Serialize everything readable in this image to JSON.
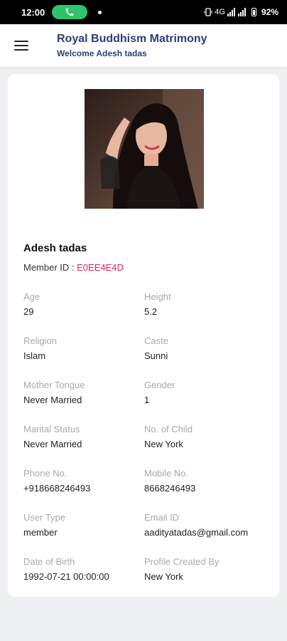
{
  "status_bar": {
    "time": "12:00",
    "network": "4G",
    "battery": "92%"
  },
  "app_bar": {
    "title": "Royal Buddhism Matrimony",
    "subtitle": "Welcome Adesh tadas"
  },
  "profile": {
    "name": "Adesh tadas",
    "member_id_label": "Member ID : ",
    "member_id": "E0EE4E4D",
    "fields": [
      {
        "label": "Age",
        "value": "29"
      },
      {
        "label": "Height",
        "value": "5.2"
      },
      {
        "label": "Religion",
        "value": "Islam"
      },
      {
        "label": "Caste",
        "value": "Sunni"
      },
      {
        "label": "Mother Tongue",
        "value": "Never Married"
      },
      {
        "label": "Gender",
        "value": "1"
      },
      {
        "label": "Marital Status",
        "value": "Never Married"
      },
      {
        "label": "No. of Child",
        "value": "New York"
      },
      {
        "label": "Phone No.",
        "value": "+918668246493"
      },
      {
        "label": "Mobile No.",
        "value": "8668246493"
      },
      {
        "label": "User Type",
        "value": "member"
      },
      {
        "label": "Email ID",
        "value": "aadityatadas@gmail.com"
      },
      {
        "label": "Date of Birth",
        "value": "1992-07-21 00:00:00"
      },
      {
        "label": "Profile Created By",
        "value": "New York"
      }
    ]
  },
  "colors": {
    "title": "#2b3f7a",
    "member_id": "#e0245e",
    "call_pill": "#2ec46a"
  }
}
